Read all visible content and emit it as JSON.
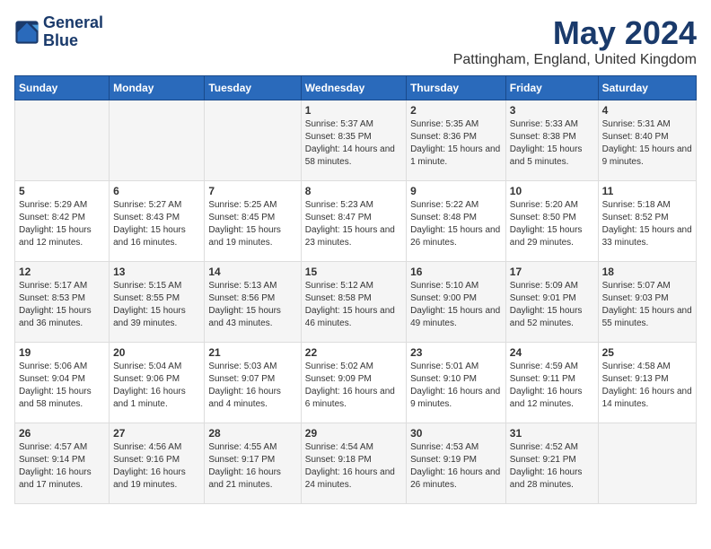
{
  "logo": {
    "line1": "General",
    "line2": "Blue"
  },
  "title": "May 2024",
  "location": "Pattingham, England, United Kingdom",
  "days_header": [
    "Sunday",
    "Monday",
    "Tuesday",
    "Wednesday",
    "Thursday",
    "Friday",
    "Saturday"
  ],
  "weeks": [
    [
      {
        "day": "",
        "info": ""
      },
      {
        "day": "",
        "info": ""
      },
      {
        "day": "",
        "info": ""
      },
      {
        "day": "1",
        "info": "Sunrise: 5:37 AM\nSunset: 8:35 PM\nDaylight: 14 hours and 58 minutes."
      },
      {
        "day": "2",
        "info": "Sunrise: 5:35 AM\nSunset: 8:36 PM\nDaylight: 15 hours and 1 minute."
      },
      {
        "day": "3",
        "info": "Sunrise: 5:33 AM\nSunset: 8:38 PM\nDaylight: 15 hours and 5 minutes."
      },
      {
        "day": "4",
        "info": "Sunrise: 5:31 AM\nSunset: 8:40 PM\nDaylight: 15 hours and 9 minutes."
      }
    ],
    [
      {
        "day": "5",
        "info": "Sunrise: 5:29 AM\nSunset: 8:42 PM\nDaylight: 15 hours and 12 minutes."
      },
      {
        "day": "6",
        "info": "Sunrise: 5:27 AM\nSunset: 8:43 PM\nDaylight: 15 hours and 16 minutes."
      },
      {
        "day": "7",
        "info": "Sunrise: 5:25 AM\nSunset: 8:45 PM\nDaylight: 15 hours and 19 minutes."
      },
      {
        "day": "8",
        "info": "Sunrise: 5:23 AM\nSunset: 8:47 PM\nDaylight: 15 hours and 23 minutes."
      },
      {
        "day": "9",
        "info": "Sunrise: 5:22 AM\nSunset: 8:48 PM\nDaylight: 15 hours and 26 minutes."
      },
      {
        "day": "10",
        "info": "Sunrise: 5:20 AM\nSunset: 8:50 PM\nDaylight: 15 hours and 29 minutes."
      },
      {
        "day": "11",
        "info": "Sunrise: 5:18 AM\nSunset: 8:52 PM\nDaylight: 15 hours and 33 minutes."
      }
    ],
    [
      {
        "day": "12",
        "info": "Sunrise: 5:17 AM\nSunset: 8:53 PM\nDaylight: 15 hours and 36 minutes."
      },
      {
        "day": "13",
        "info": "Sunrise: 5:15 AM\nSunset: 8:55 PM\nDaylight: 15 hours and 39 minutes."
      },
      {
        "day": "14",
        "info": "Sunrise: 5:13 AM\nSunset: 8:56 PM\nDaylight: 15 hours and 43 minutes."
      },
      {
        "day": "15",
        "info": "Sunrise: 5:12 AM\nSunset: 8:58 PM\nDaylight: 15 hours and 46 minutes."
      },
      {
        "day": "16",
        "info": "Sunrise: 5:10 AM\nSunset: 9:00 PM\nDaylight: 15 hours and 49 minutes."
      },
      {
        "day": "17",
        "info": "Sunrise: 5:09 AM\nSunset: 9:01 PM\nDaylight: 15 hours and 52 minutes."
      },
      {
        "day": "18",
        "info": "Sunrise: 5:07 AM\nSunset: 9:03 PM\nDaylight: 15 hours and 55 minutes."
      }
    ],
    [
      {
        "day": "19",
        "info": "Sunrise: 5:06 AM\nSunset: 9:04 PM\nDaylight: 15 hours and 58 minutes."
      },
      {
        "day": "20",
        "info": "Sunrise: 5:04 AM\nSunset: 9:06 PM\nDaylight: 16 hours and 1 minute."
      },
      {
        "day": "21",
        "info": "Sunrise: 5:03 AM\nSunset: 9:07 PM\nDaylight: 16 hours and 4 minutes."
      },
      {
        "day": "22",
        "info": "Sunrise: 5:02 AM\nSunset: 9:09 PM\nDaylight: 16 hours and 6 minutes."
      },
      {
        "day": "23",
        "info": "Sunrise: 5:01 AM\nSunset: 9:10 PM\nDaylight: 16 hours and 9 minutes."
      },
      {
        "day": "24",
        "info": "Sunrise: 4:59 AM\nSunset: 9:11 PM\nDaylight: 16 hours and 12 minutes."
      },
      {
        "day": "25",
        "info": "Sunrise: 4:58 AM\nSunset: 9:13 PM\nDaylight: 16 hours and 14 minutes."
      }
    ],
    [
      {
        "day": "26",
        "info": "Sunrise: 4:57 AM\nSunset: 9:14 PM\nDaylight: 16 hours and 17 minutes."
      },
      {
        "day": "27",
        "info": "Sunrise: 4:56 AM\nSunset: 9:16 PM\nDaylight: 16 hours and 19 minutes."
      },
      {
        "day": "28",
        "info": "Sunrise: 4:55 AM\nSunset: 9:17 PM\nDaylight: 16 hours and 21 minutes."
      },
      {
        "day": "29",
        "info": "Sunrise: 4:54 AM\nSunset: 9:18 PM\nDaylight: 16 hours and 24 minutes."
      },
      {
        "day": "30",
        "info": "Sunrise: 4:53 AM\nSunset: 9:19 PM\nDaylight: 16 hours and 26 minutes."
      },
      {
        "day": "31",
        "info": "Sunrise: 4:52 AM\nSunset: 9:21 PM\nDaylight: 16 hours and 28 minutes."
      },
      {
        "day": "",
        "info": ""
      }
    ]
  ]
}
